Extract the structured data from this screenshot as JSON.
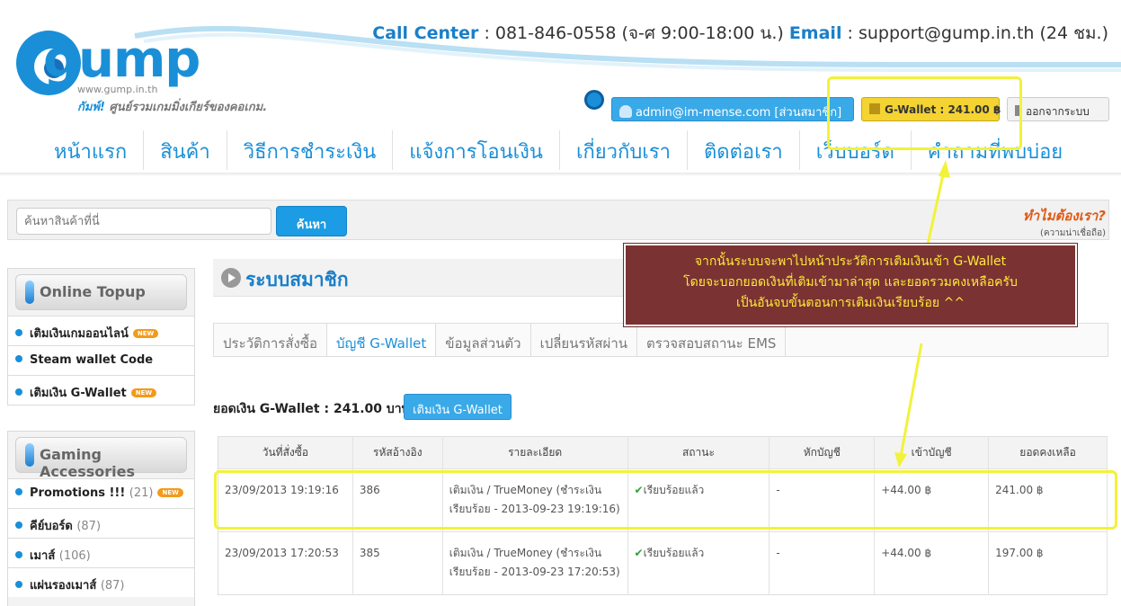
{
  "header": {
    "logo_text": "gump",
    "logo_url": "www.gump.in.th",
    "logo_brand": "กัมพ์!",
    "logo_tagline": "ศูนย์รวมเกมมิ่งเกียร์ของคอเกม.",
    "call_center_label": "Call Center",
    "call_center_value": ": 081-846-0558 (จ-ศ 9:00-18:00 น.)",
    "email_label": "Email",
    "email_value": ": support@gump.in.th (24 ชม.)"
  },
  "userbar": {
    "user": "admin@im-mense.com [ส่วนสมาชิก]",
    "wallet": "G-Wallet : 241.00 ฿",
    "logout": "ออกจากระบบ"
  },
  "nav": [
    "หน้าแรก",
    "สินค้า",
    "วิธีการชำระเงิน",
    "แจ้งการโอนเงิน",
    "เกี่ยวกับเรา",
    "ติดต่อเรา",
    "เว็บบอร์ด",
    "คำถามที่พบบ่อย"
  ],
  "search": {
    "placeholder": "ค้นหาสินค้าที่นี่",
    "button": "ค้นหา",
    "why_title": "ทำไมต้องเรา?",
    "why_sub": "(ความน่าเชื่อถือ)"
  },
  "sidebar": {
    "online_topup": {
      "title": "Online Topup",
      "items": [
        {
          "label": "เติมเงินเกมออนไลน์",
          "new": "NEW"
        },
        {
          "label": "Steam wallet Code"
        },
        {
          "label": "เติมเงิน G-Wallet",
          "new": "NEW"
        }
      ]
    },
    "accessories": {
      "title": "Gaming Accessories",
      "items": [
        {
          "label": "Promotions !!!",
          "count": "(21)",
          "new": "NEW"
        },
        {
          "label": "คีย์บอร์ด",
          "count": "(87)"
        },
        {
          "label": "เมาส์",
          "count": "(106)"
        },
        {
          "label": "แผ่นรองเมาส์",
          "count": "(87)"
        }
      ]
    }
  },
  "main": {
    "section_title": "ระบบสมาชิก",
    "tabs": [
      "ประวัติการสั่งซื้อ",
      "บัญชี G-Wallet",
      "ข้อมูลส่วนตัว",
      "เปลี่ยนรหัสผ่าน",
      "ตรวจสอบสถานะ EMS"
    ],
    "balance": "ยอดเงิน G-Wallet : 241.00 บาท",
    "topup_button": "เติมเงิน G-Wallet",
    "table": {
      "headers": [
        "วันที่สั่งซื้อ",
        "รหัสอ้างอิง",
        "รายละเอียด",
        "สถานะ",
        "หักบัญชี",
        "เข้าบัญชี",
        "ยอดคงเหลือ"
      ],
      "rows": [
        [
          "23/09/2013 19:19:16",
          "386",
          "เติมเงิน / TrueMoney (ชำระเงินเรียบร้อย - 2013-09-23 19:19:16)",
          "เรียบร้อยแล้ว",
          "-",
          "+44.00 ฿",
          "241.00 ฿"
        ],
        [
          "23/09/2013 17:20:53",
          "385",
          "เติมเงิน / TrueMoney (ชำระเงินเรียบร้อย - 2013-09-23 17:20:53)",
          "เรียบร้อยแล้ว",
          "-",
          "+44.00 ฿",
          "197.00 ฿"
        ]
      ]
    }
  },
  "callout": {
    "line1": "จากนั้นระบบจะพาไปหน้าประวัติการเติมเงินเข้า G-Wallet",
    "line2": "โดยจะบอกยอดเงินที่เติมเข้ามาล่าสุด และยอดรวมคงเหลือครับ",
    "line3": "เป็นอันจบขั้นตอนการเติมเงินเรียบร้อย ^^"
  },
  "colors": {
    "accent": "#1a8fd8",
    "annotation": "#f2f23a",
    "callout_bg": "#7a3232"
  }
}
